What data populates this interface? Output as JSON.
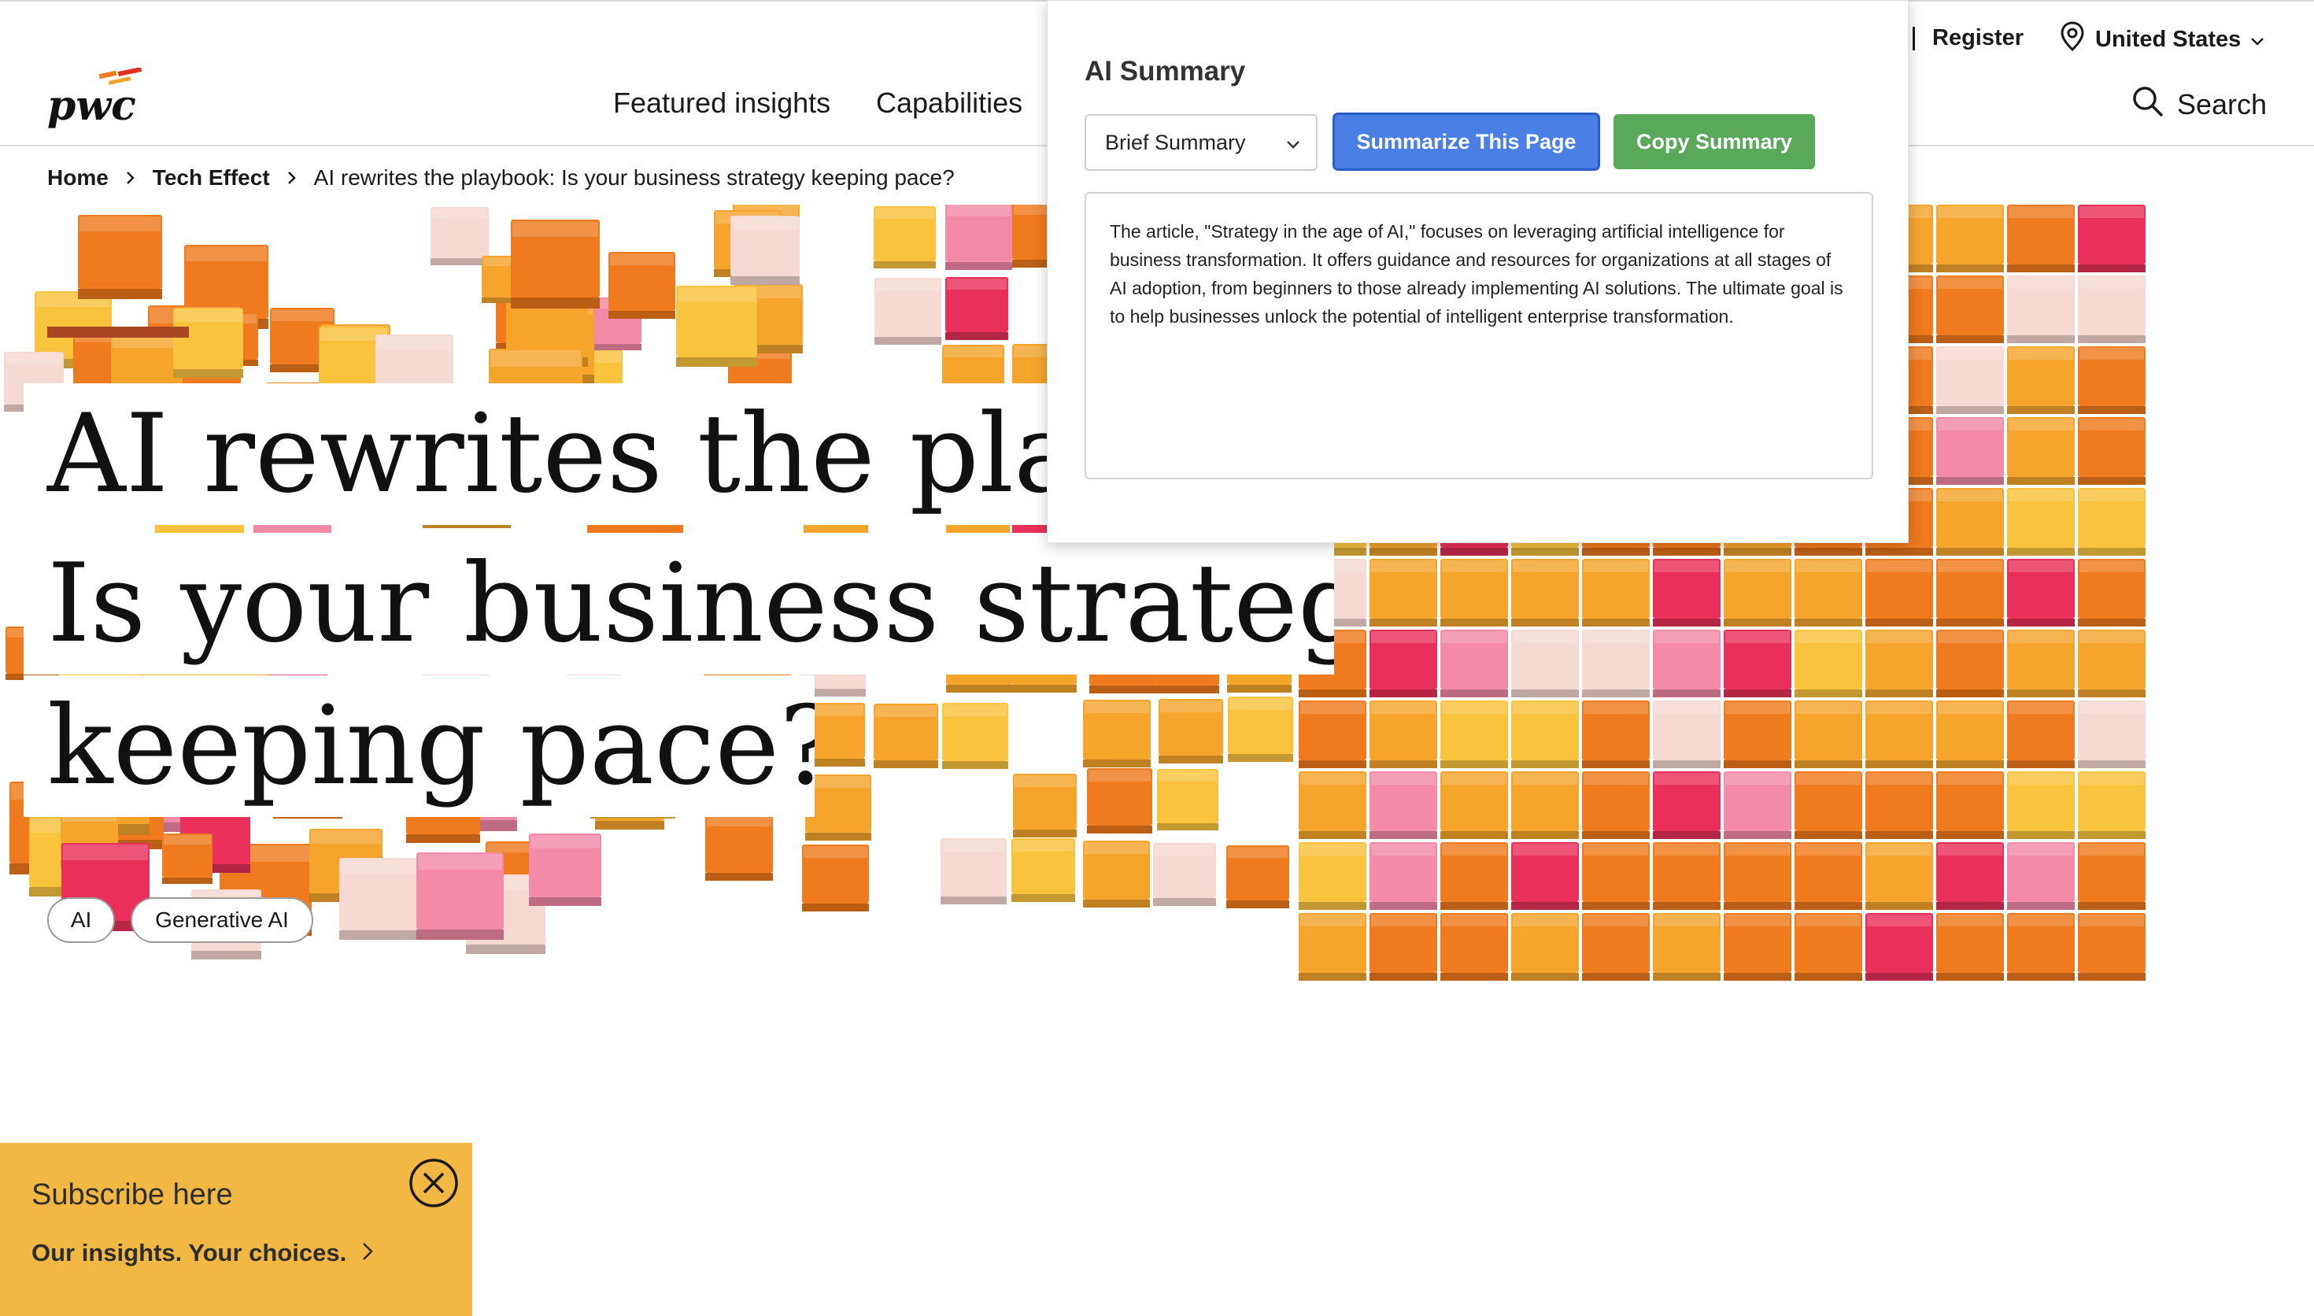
{
  "header": {
    "logo_text": "pwc",
    "nav": [
      {
        "label": "Featured insights"
      },
      {
        "label": "Capabilities"
      }
    ],
    "utility": {
      "register_label": "Register",
      "locale_label": "United States",
      "search_label": "Search"
    }
  },
  "breadcrumb": {
    "items": [
      "Home",
      "Tech Effect"
    ],
    "current": "AI rewrites the playbook: Is your business strategy keeping pace?"
  },
  "hero": {
    "title_lines": [
      "AI rewrites the playbook:",
      "Is your business strategy",
      "keeping pace?"
    ],
    "tags": [
      "AI",
      "Generative AI"
    ]
  },
  "subscribe": {
    "title": "Subscribe here",
    "link_label": "Our insights. Your choices."
  },
  "ai_summary": {
    "title": "AI Summary",
    "select_value": "Brief Summary",
    "summarize_label": "Summarize This Page",
    "copy_label": "Copy Summary",
    "summary_text": "The article, \"Strategy in the age of AI,\" focuses on leveraging artificial intelligence for business transformation.  It offers guidance and resources for organizations at all stages of AI adoption, from beginners to those already implementing AI solutions.  The ultimate goal is to help businesses unlock the potential of intelligent enterprise transformation."
  },
  "colors": {
    "brand_orange": "#e0301e",
    "accent_bar": "#a84722",
    "subscribe_bg": "#f2b843",
    "summarize_button": "#4a7fe6",
    "copy_button": "#5aa85a",
    "cube_palette": [
      "#f07a1e",
      "#f5a52c",
      "#f9c33e",
      "#e8305a",
      "#f28aa8",
      "#f6d9d2"
    ]
  },
  "icons": {
    "breadcrumb_separator": "chevron-right-icon",
    "locale": "location-pin-icon",
    "locale_dropdown": "chevron-down-icon",
    "search": "search-icon",
    "subscribe_close": "close-circle-icon",
    "subscribe_link": "chevron-right-icon",
    "select_dropdown": "chevron-down-icon"
  }
}
